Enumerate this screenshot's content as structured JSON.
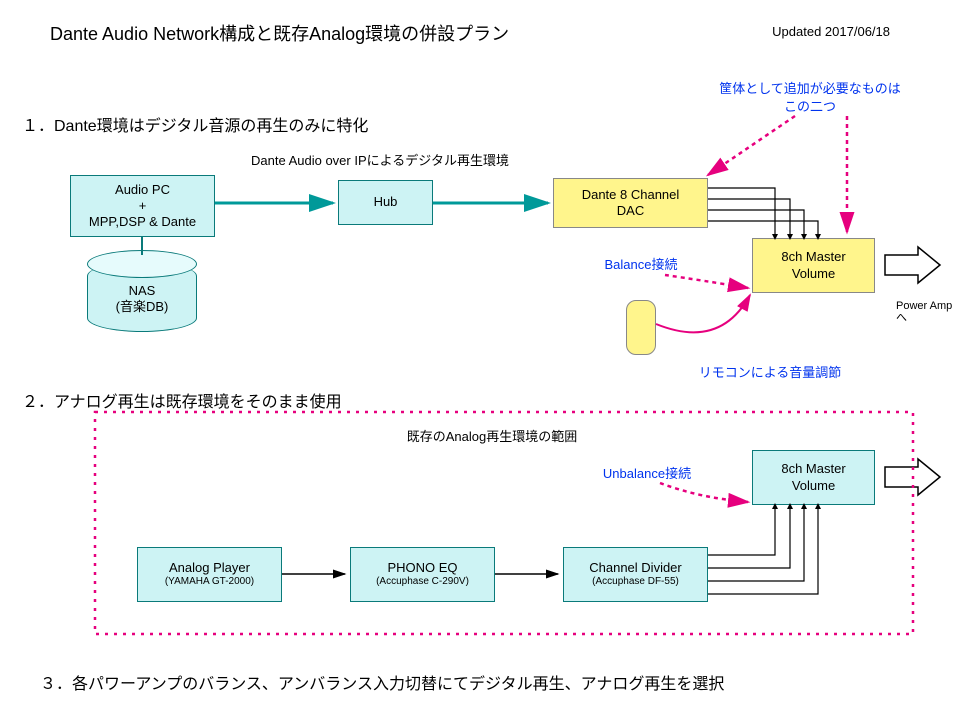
{
  "title": "Dante Audio Network構成と既存Analog環境の併設プラン",
  "updated": "Updated 2017/06/18",
  "section1": "１．Dante環境はデジタル音源の再生のみに特化",
  "section2": "２．アナログ再生は既存環境をそのまま使用",
  "section3": "３．各パワーアンプのバランス、アンバランス入力切替にてデジタル再生、アナログ再生を選択",
  "note_top1": "筐体として追加が必要なものは",
  "note_top2": "この二つ",
  "dante_label": "Dante Audio over IPによるデジタル再生環境",
  "analog_label": "既存のAnalog再生環境の範囲",
  "balance": "Balance接続",
  "unbalance": "Unbalance接続",
  "remote_note": "リモコンによる音量調節",
  "boxes": {
    "audiopc1": "Audio PC",
    "audiopc2": "+",
    "audiopc3": "MPP,DSP & Dante",
    "hub": "Hub",
    "dac1": "Dante 8 Channel",
    "dac2": "DAC",
    "vol1a": "8ch Master",
    "vol1b": "Volume",
    "nas1": "NAS",
    "nas2": "(音楽DB)",
    "player1": "Analog Player",
    "player2": "(YAMAHA GT-2000)",
    "phono1": "PHONO EQ",
    "phono2": "(Accuphase C-290V)",
    "divider1": "Channel Divider",
    "divider2": "(Accuphase DF-55)",
    "vol2a": "8ch Master",
    "vol2b": "Volume"
  },
  "out": "Power Ampへ"
}
